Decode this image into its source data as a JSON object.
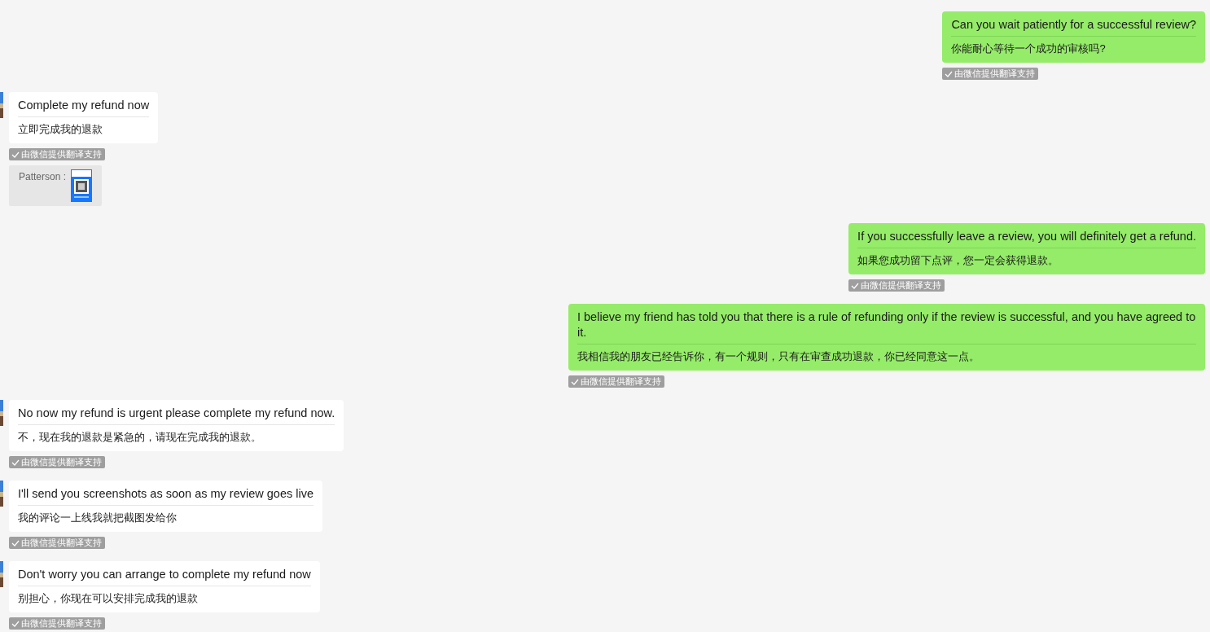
{
  "messages": [
    {
      "kind": "text",
      "outgoing": true,
      "text": "Can you wait patiently for a successful review?",
      "translation": "你能耐心等待一个成功的审核吗?",
      "note": "由微信提供翻译支持"
    },
    {
      "kind": "text",
      "outgoing": false,
      "text": "Complete my refund now",
      "translation": "立即完成我的退款",
      "note": "由微信提供翻译支持"
    },
    {
      "outgoing": false,
      "sender": "Patterson :"
    },
    {
      "kind": "text",
      "outgoing": true,
      "text": "If you successfully leave a review, you will definitely get a refund.",
      "translation": "如果您成功留下点评，您一定会获得退款。",
      "note": "由微信提供翻译支持"
    },
    {
      "kind": "text",
      "outgoing": true,
      "text": "I believe my friend has told you that there is a rule of refunding only if the review is successful, and you have agreed to it.",
      "translation": "我相信我的朋友已经告诉你，有一个规则，只有在审查成功退款，你已经同意这一点。",
      "note": "由微信提供翻译支持"
    },
    {
      "kind": "text",
      "outgoing": false,
      "text": "No now my refund is urgent please complete my refund now.",
      "translation": "不，现在我的退款是紧急的，请现在完成我的退款。",
      "note": "由微信提供翻译支持"
    },
    {
      "kind": "text",
      "outgoing": false,
      "text": "I'll send you screenshots as soon as my review goes live",
      "translation": "我的评论一上线我就把截图发给你",
      "note": "由微信提供翻译支持"
    },
    {
      "kind": "text",
      "outgoing": false,
      "text": "Don't worry you can arrange to complete my refund now",
      "translation": "别担心，你现在可以安排完成我的退款",
      "note": "由微信提供翻译支持"
    }
  ]
}
